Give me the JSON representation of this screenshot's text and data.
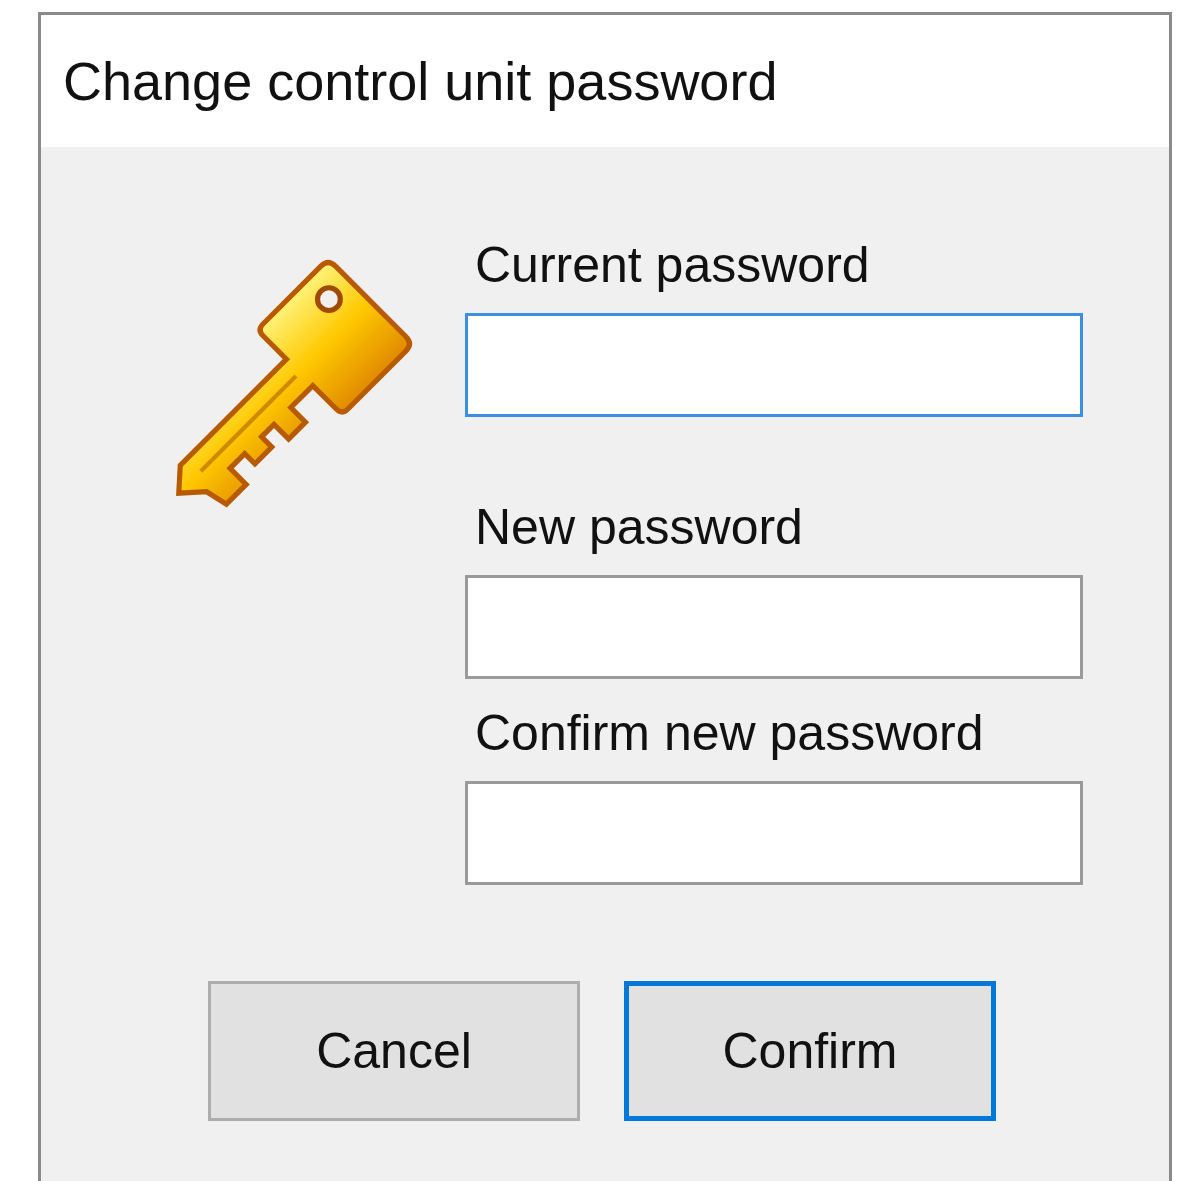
{
  "window": {
    "title": "Change control unit password"
  },
  "fields": [
    {
      "label": "Current password",
      "focused": true
    },
    {
      "label": "New password",
      "focused": false
    },
    {
      "label": "Confirm new password",
      "focused": false
    }
  ],
  "buttons": [
    {
      "label": "Cancel",
      "default": false
    },
    {
      "label": "Confirm",
      "default": true
    }
  ]
}
